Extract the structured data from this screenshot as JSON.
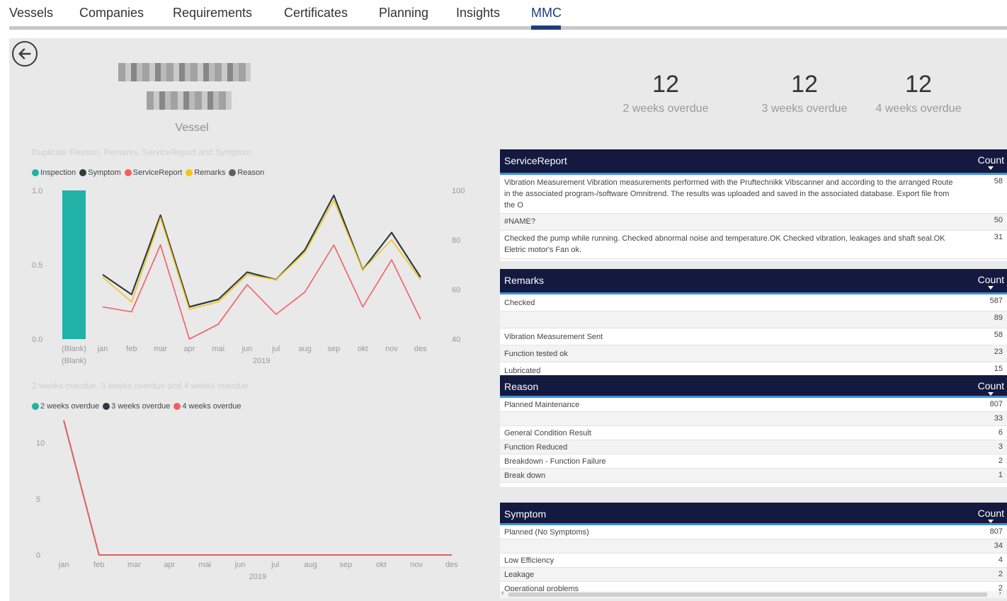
{
  "nav": {
    "tabs": [
      {
        "label": "Vessels"
      },
      {
        "label": "Companies"
      },
      {
        "label": "Requirements"
      },
      {
        "label": "Certificates"
      },
      {
        "label": "Planning"
      },
      {
        "label": "Insights"
      },
      {
        "label": "MMC"
      }
    ],
    "active_tab": "MMC"
  },
  "vessel_label": "Vessel",
  "kpis": [
    {
      "value": "12",
      "label": "2 weeks overdue"
    },
    {
      "value": "12",
      "label": "3 weeks overdue"
    },
    {
      "value": "12",
      "label": "4 weeks overdue"
    }
  ],
  "chart_data": [
    {
      "type": "line",
      "title": "Duplicate Reason, Remarks, ServiceReport and Symptom",
      "legend": [
        "Inspection",
        "Symptom",
        "ServiceReport",
        "Remarks",
        "Reason"
      ],
      "colors": {
        "Inspection": "#20b2a6",
        "Symptom": "#2e3b3e",
        "ServiceReport": "#f2605e",
        "Remarks": "#f4c414",
        "Reason": "#586268"
      },
      "bar": {
        "category": "(Blank)",
        "category2": "(Blank)",
        "series": "Inspection",
        "value": 1.0
      },
      "categories": [
        "jan",
        "feb",
        "mar",
        "apr",
        "mai",
        "jun",
        "jul",
        "aug",
        "sep",
        "okt",
        "nov",
        "des"
      ],
      "x_group_label": "2019",
      "yleft_ticks": [
        "0.0",
        "0.5",
        "1.0"
      ],
      "yleft_lim": [
        0,
        1
      ],
      "yright_ticks": [
        "40",
        "60",
        "80",
        "100"
      ],
      "yright_lim": [
        40,
        100
      ],
      "series": [
        {
          "name": "Symptom",
          "axis": "right",
          "values": [
            66,
            58,
            90,
            53,
            56,
            67,
            64,
            76,
            98,
            68,
            83,
            65
          ]
        },
        {
          "name": "Remarks",
          "axis": "right",
          "values": [
            65,
            55,
            89,
            52,
            55,
            66,
            64,
            75,
            96,
            68,
            80,
            64
          ]
        },
        {
          "name": "ServiceReport",
          "axis": "right",
          "values": [
            53,
            51,
            78,
            40,
            46,
            62,
            50,
            59,
            78,
            53,
            72,
            48
          ]
        }
      ]
    },
    {
      "type": "line",
      "title": "2 weeks overdue, 3 weeks overdue and 4 weeks overdue",
      "legend": [
        "2 weeks overdue",
        "3 weeks overdue",
        "4 weeks overdue"
      ],
      "colors": {
        "2 weeks overdue": "#20b2a6",
        "3 weeks overdue": "#2e3b3e",
        "4 weeks overdue": "#f2605e"
      },
      "categories": [
        "jan",
        "feb",
        "mar",
        "apr",
        "mai",
        "jun",
        "jul",
        "aug",
        "sep",
        "okt",
        "nov",
        "des"
      ],
      "x_group_label": "2019",
      "y_ticks": [
        "0",
        "5",
        "10"
      ],
      "ylim": [
        0,
        12.5
      ],
      "series": [
        {
          "name": "2 weeks overdue",
          "values": [
            12,
            0,
            0,
            0,
            0,
            0,
            0,
            0,
            0,
            0,
            0,
            0
          ]
        },
        {
          "name": "3 weeks overdue",
          "values": [
            12,
            0,
            0,
            0,
            0,
            0,
            0,
            0,
            0,
            0,
            0,
            0
          ]
        },
        {
          "name": "4 weeks overdue",
          "values": [
            12,
            0,
            0,
            0,
            0,
            0,
            0,
            0,
            0,
            0,
            0,
            0
          ]
        }
      ]
    }
  ],
  "tables": {
    "service_report": {
      "header": "ServiceReport",
      "count_header": "Count",
      "rows": [
        {
          "text": "Vibration Measurement Vibration measurements performed with the Pruftechnikk Vibscanner and according to the arranged Route in the associated program-/software Omnitrend. The results was uploaded and saved in the associated database. Export file from the O",
          "count": "58"
        },
        {
          "text": "#NAME?",
          "count": "50"
        },
        {
          "text": "Checked the pump while running. Checked abnormal noise and temperature.OK Checked vibration, leakages and shaft seal.OK Eletric motor's Fan ok.",
          "count": "31"
        }
      ]
    },
    "remarks": {
      "header": "Remarks",
      "count_header": "Count",
      "rows": [
        {
          "text": "Checked",
          "count": "587"
        },
        {
          "text": "",
          "count": "89"
        },
        {
          "text": "Vibration Measurement Sent",
          "count": "58"
        },
        {
          "text": "Function tested ok",
          "count": "23"
        },
        {
          "text": "Lubricated",
          "count": "15"
        }
      ]
    },
    "reason": {
      "header": "Reason",
      "count_header": "Count",
      "rows": [
        {
          "text": "Planned Maintenance",
          "count": "807"
        },
        {
          "text": "",
          "count": "33"
        },
        {
          "text": "General Condition Result",
          "count": "6"
        },
        {
          "text": "Function Reduced",
          "count": "3"
        },
        {
          "text": "Breakdown - Function Failure",
          "count": "2"
        },
        {
          "text": "Break down",
          "count": "1"
        }
      ]
    },
    "symptom": {
      "header": "Symptom",
      "count_header": "Count",
      "rows": [
        {
          "text": "Planned (No Symptoms)",
          "count": "807"
        },
        {
          "text": "",
          "count": "34"
        },
        {
          "text": "Low Efficiency",
          "count": "4"
        },
        {
          "text": "Leakage",
          "count": "2"
        },
        {
          "text": "Operational problems",
          "count": "2"
        }
      ]
    }
  }
}
